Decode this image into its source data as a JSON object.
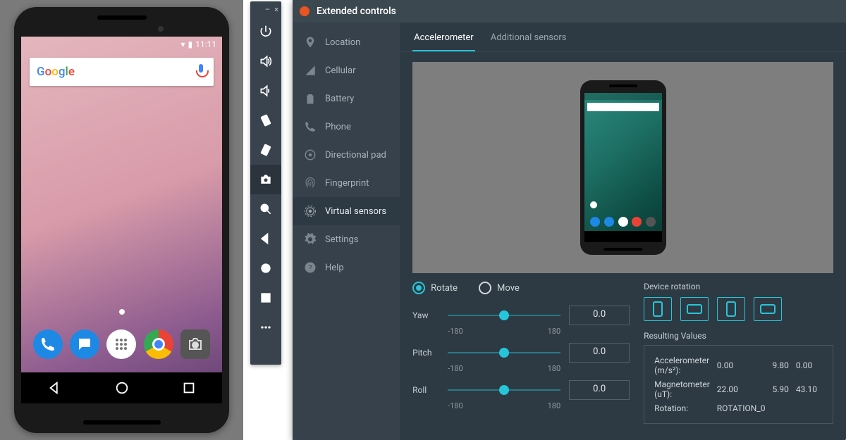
{
  "emulator": {
    "status_time": "11:11",
    "search_placeholder": "Google",
    "dock": [
      "phone",
      "messages",
      "apps",
      "chrome",
      "camera"
    ]
  },
  "toolbar": {
    "buttons": [
      "power",
      "volume-up",
      "volume-down",
      "rotate-left",
      "rotate-right",
      "camera",
      "zoom",
      "back",
      "home",
      "overview",
      "more"
    ]
  },
  "ext": {
    "title": "Extended controls",
    "sidebar": [
      {
        "icon": "location",
        "label": "Location"
      },
      {
        "icon": "cellular",
        "label": "Cellular"
      },
      {
        "icon": "battery",
        "label": "Battery"
      },
      {
        "icon": "phone",
        "label": "Phone"
      },
      {
        "icon": "dpad",
        "label": "Directional pad"
      },
      {
        "icon": "fingerprint",
        "label": "Fingerprint"
      },
      {
        "icon": "sensors",
        "label": "Virtual sensors"
      },
      {
        "icon": "settings",
        "label": "Settings"
      },
      {
        "icon": "help",
        "label": "Help"
      }
    ],
    "active_sidebar": 6,
    "tabs": [
      "Accelerometer",
      "Additional sensors"
    ],
    "active_tab": 0,
    "mode": {
      "rotate": "Rotate",
      "move": "Move",
      "selected": "rotate"
    },
    "sliders": {
      "yaw": {
        "label": "Yaw",
        "min": "-180",
        "max": "180",
        "value": "0.0"
      },
      "pitch": {
        "label": "Pitch",
        "min": "-180",
        "max": "180",
        "value": "0.0"
      },
      "roll": {
        "label": "Roll",
        "min": "-180",
        "max": "180",
        "value": "0.0"
      }
    },
    "device_rotation_label": "Device rotation",
    "results": {
      "label": "Resulting Values",
      "rows": [
        {
          "name": "Accelerometer (m/s²):",
          "v": [
            "0.00",
            "9.80",
            "0.00"
          ]
        },
        {
          "name": "Magnetometer (uT):",
          "v": [
            "22.00",
            "5.90",
            "43.10"
          ]
        },
        {
          "name": "Rotation:",
          "v": [
            "ROTATION_0"
          ]
        }
      ]
    }
  }
}
